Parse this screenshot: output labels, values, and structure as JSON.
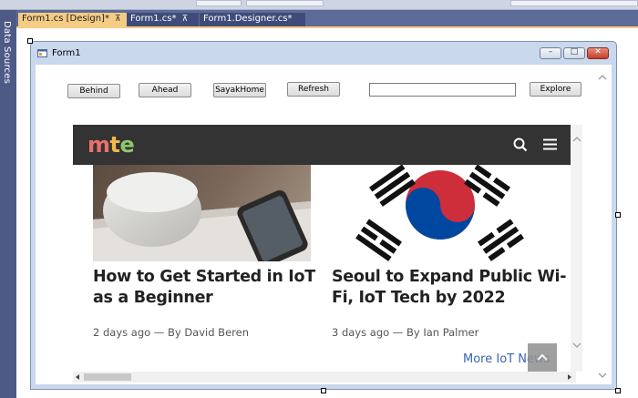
{
  "ide": {
    "side_panel_label": "Data Sources",
    "tabs": [
      {
        "label": "Form1.cs [Design]*",
        "pin": "⊼",
        "close": "×",
        "active": true
      },
      {
        "label": "Form1.cs*",
        "pin": "⊼",
        "active": false
      },
      {
        "label": "Form1.Designer.cs*",
        "active": false
      }
    ]
  },
  "form": {
    "title": "Form1",
    "caption_buttons": {
      "minimize": "–",
      "maximize": "□",
      "close": "✕"
    },
    "toolbar": {
      "back_label": "Behind",
      "forward_label": "Ahead",
      "home_label": "SayakHome",
      "refresh_label": "Refresh",
      "url_value": "",
      "go_label": "Explore"
    }
  },
  "site": {
    "logo": {
      "m": "m",
      "t": "t",
      "e": "e"
    },
    "logo_colors": {
      "m": "#e8716c",
      "t": "#f2b84b",
      "e": "#8fc86a"
    },
    "articles": [
      {
        "title_line1": "How to Get Started in IoT",
        "title_line2": "as a Beginner",
        "meta": "2 days ago — By David Beren"
      },
      {
        "title_line1": "Seoul to Expand Public Wi-",
        "title_line2": "Fi, IoT Tech by 2022",
        "meta": "3 days ago — By Ian Palmer"
      }
    ],
    "more_link": "More IoT News",
    "icons": {
      "search": "search-icon",
      "menu": "hamburger-menu-icon",
      "scroll_top": "chevron-up-icon"
    }
  }
}
